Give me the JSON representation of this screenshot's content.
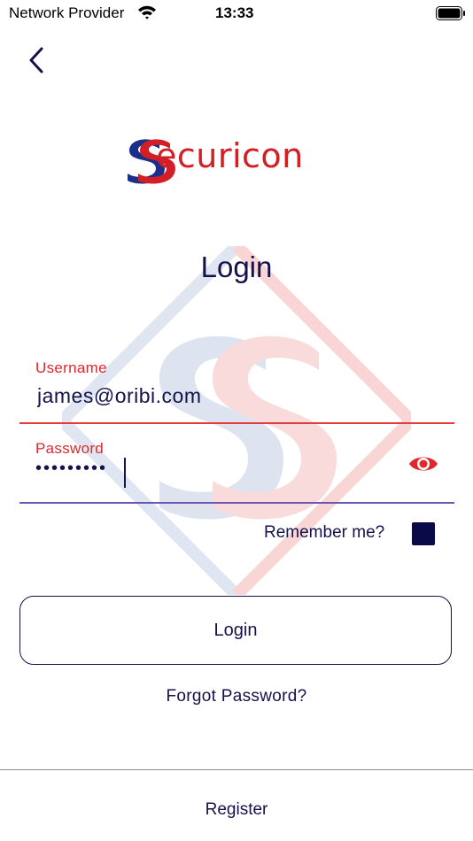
{
  "status_bar": {
    "carrier": "Network Provider",
    "time": "13:33",
    "icons": [
      "wifi-icon",
      "battery-icon"
    ]
  },
  "header": {
    "back_icon": "chevron-left-icon"
  },
  "logo": {
    "text": "ecuricon",
    "brand_colors": {
      "red": "#d21f26",
      "blue": "#1a2f8a"
    }
  },
  "page": {
    "title": "Login"
  },
  "form": {
    "username": {
      "label": "Username",
      "value": "james@oribi.com"
    },
    "password": {
      "label": "Password",
      "masked_value": "•••••••••",
      "toggle_icon": "eye-icon"
    },
    "remember": {
      "label": "Remember me?",
      "checked": true
    }
  },
  "actions": {
    "login_label": "Login",
    "forgot_label": "Forgot Password?",
    "register_label": "Register"
  },
  "colors": {
    "primary": "#14124a",
    "accent_red": "#e1262c",
    "focus_underline": "#6b57b3"
  }
}
